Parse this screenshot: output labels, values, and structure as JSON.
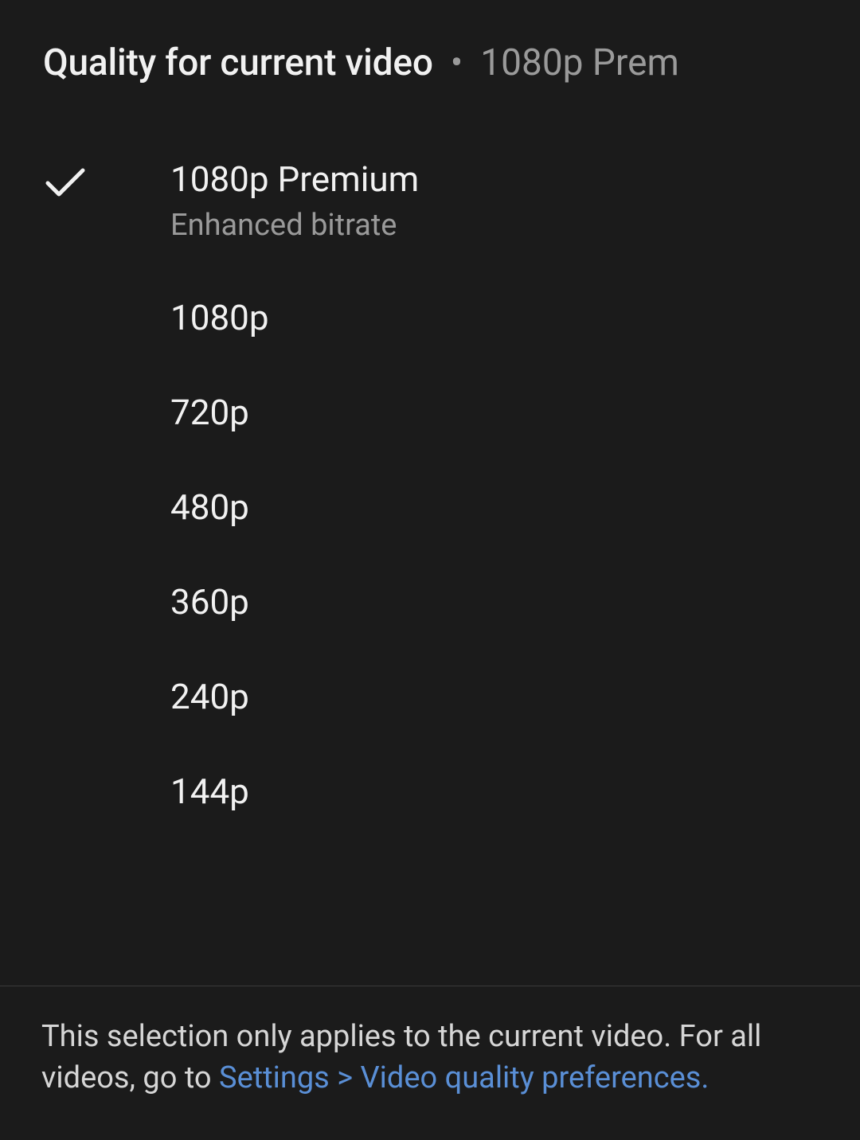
{
  "header": {
    "title": "Quality for current video",
    "separator": "•",
    "current": "1080p Prem"
  },
  "options": [
    {
      "label": "1080p Premium",
      "sub": "Enhanced bitrate",
      "selected": true
    },
    {
      "label": "1080p",
      "sub": "",
      "selected": false
    },
    {
      "label": "720p",
      "sub": "",
      "selected": false
    },
    {
      "label": "480p",
      "sub": "",
      "selected": false
    },
    {
      "label": "360p",
      "sub": "",
      "selected": false
    },
    {
      "label": "240p",
      "sub": "",
      "selected": false
    },
    {
      "label": "144p",
      "sub": "",
      "selected": false
    }
  ],
  "footer": {
    "text_before": "This selection only applies to the current video. For all videos, go to ",
    "link": "Settings > Video quality preferences."
  },
  "colors": {
    "background": "#1b1b1b",
    "text_primary": "#f1f1f1",
    "text_secondary": "#9a9a9a",
    "link": "#5a8fd6",
    "divider": "#3a3a3a"
  }
}
